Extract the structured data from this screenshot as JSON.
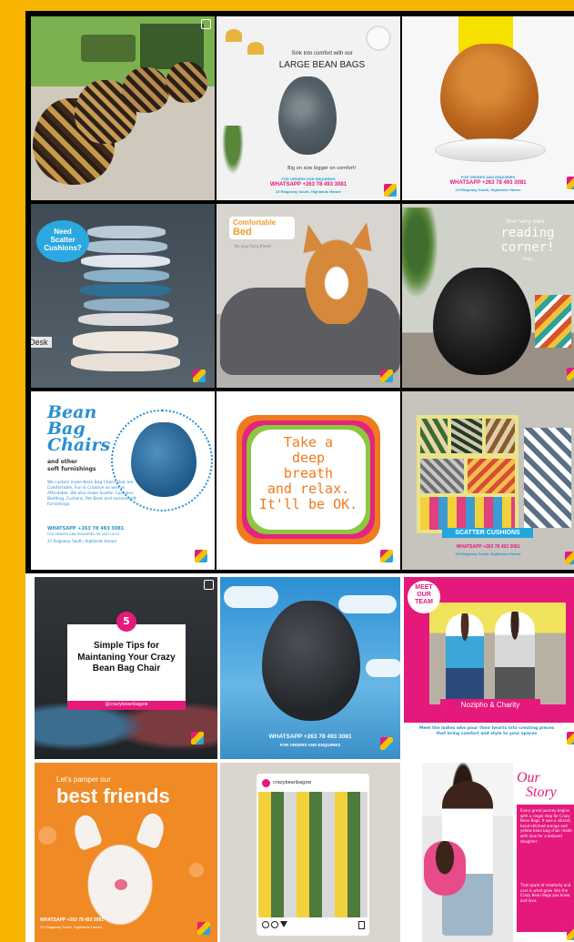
{
  "grid_top": {
    "r1c2": {
      "headline_small": "Sink into comfort with our",
      "headline_big": "LARGE BEAN BAGS",
      "tagline": "Big on size bigger on comfort!",
      "footer_top": "FOR ORDERS AND ENQUIRIES",
      "whatsapp": "WHATSAPP +263 78 493 3081",
      "address": "23 Ridgeway South, Highlands Harare"
    },
    "r1c3": {
      "footer_top": "FOR ORDERS AND ENQUIRIES",
      "whatsapp": "WHATSAPP +263 78 493 3081",
      "address": "23 Ridgeway South, Highlands Harare"
    },
    "r2c1": {
      "bubble": "Need Scatter Cushions?",
      "overlay": "Desk"
    },
    "r2c2": {
      "word1": "Comfortable",
      "word2": "Bed",
      "sub": "for your furry friend"
    },
    "r2c3": {
      "line1": "Your very own",
      "line2": "reading",
      "line3": "corner!",
      "sub": "Relax"
    },
    "r3c1": {
      "title1": "Bean",
      "title2": "Bag",
      "title3": "Chairs",
      "sub1": "and other",
      "sub2": "soft furnishings",
      "body": "We custom make Bean Bag Chairs that are Comfortable, Fun & Creative as well as Affordable. We also make Scatter Cushions, Bedding, Curtains, Pet Beds and various soft furnishings.",
      "whatsapp": "WHATSAPP +263 78 493 3081",
      "orders": "FOR ORDERS AND ENQUIRIES OR VISIT US AT",
      "address": "23 Ridgeway South, Highlands Harare"
    },
    "r3c2": {
      "line1": "Take a",
      "line2": "deep",
      "line3": "breath",
      "line4": "and relax.",
      "line5": "It'll be OK."
    },
    "r3c3": {
      "banner": "SCATTER CUSHIONS",
      "whatsapp": "WHATSAPP +263 78 493 3081",
      "address": "23 Ridgeway South, Highlands Harare"
    }
  },
  "grid_bottom": {
    "r1c1": {
      "badge": "5",
      "title": "Simple Tips for Maintaning Your Crazy Bean Bag Chair",
      "handle": "@crazybeanbagzw"
    },
    "r1c2": {
      "whatsapp": "WHATSAPP +263 78 493 3081",
      "orders": "FOR ORDERS AND ENQUIRIES"
    },
    "r1c3": {
      "badge_line1": "MEET",
      "badge_line2": "OUR",
      "badge_line3": "TEAM",
      "names": "Nozipho & Charity",
      "caption": "Meet the ladies who pour their hearts into creating pieces that bring comfort and style to your spaces"
    },
    "r2c1": {
      "small": "Let's pamper our",
      "big": "best friends",
      "whatsapp": "WHATSAPP +263 78 493 3081",
      "address": "23 Ridgeway South, Highlands Harare"
    },
    "r2c2": {
      "username": "crazybeanbagzw"
    },
    "r2c3": {
      "title1": "Our",
      "title2": "Story",
      "para1": "Every great journey begins with a single step for Crazy Bean Bags. It was a vibrant, hand-stitched orange and yellow bean bag chair made with love for a beloved daughter.",
      "para2": "That spark of creativity and care is what grew into the Crazy Bean Bags you know and love."
    }
  }
}
